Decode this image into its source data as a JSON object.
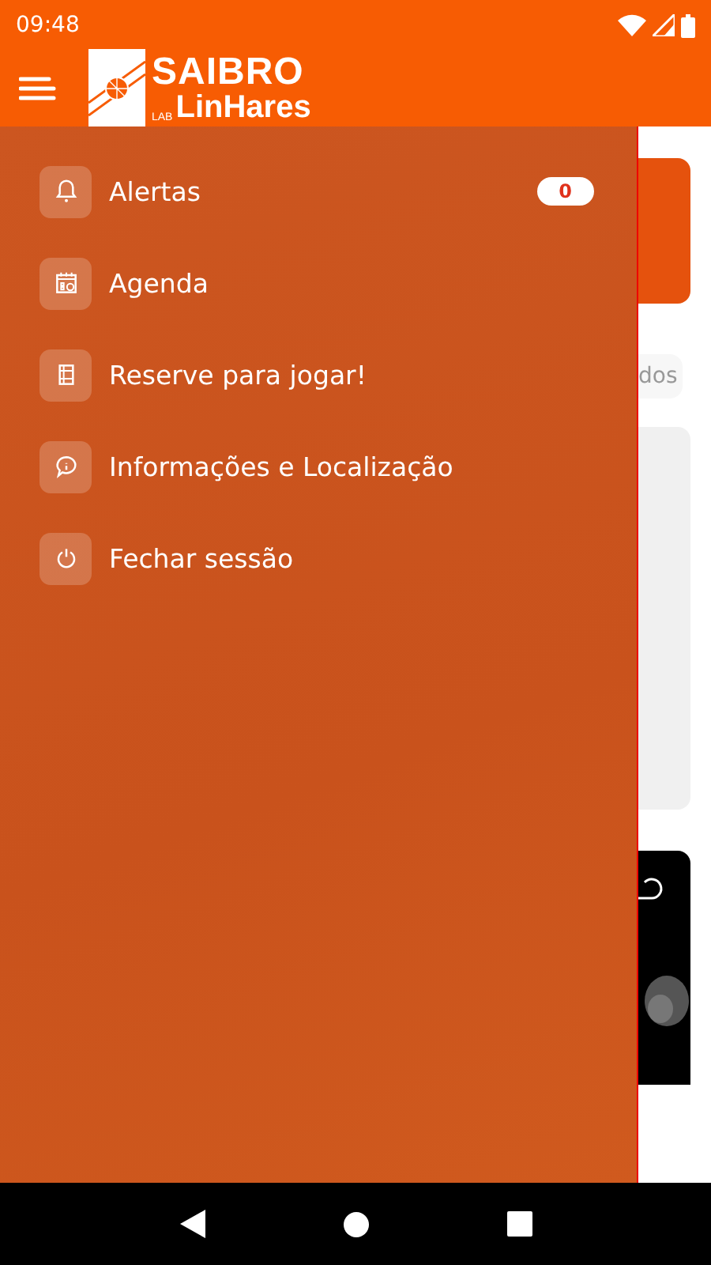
{
  "status_bar": {
    "time": "09:48"
  },
  "app_bar": {
    "logo": {
      "title": "SAIBRO",
      "tag": "LAB",
      "subtitle": "LinHares"
    }
  },
  "drawer": {
    "items": [
      {
        "label": "Alertas",
        "badge": "0"
      },
      {
        "label": "Agenda"
      },
      {
        "label": "Reserve para jogar!"
      },
      {
        "label": "Informações e Localização"
      },
      {
        "label": "Fechar sessão"
      }
    ]
  },
  "background": {
    "chip": "dos"
  }
}
